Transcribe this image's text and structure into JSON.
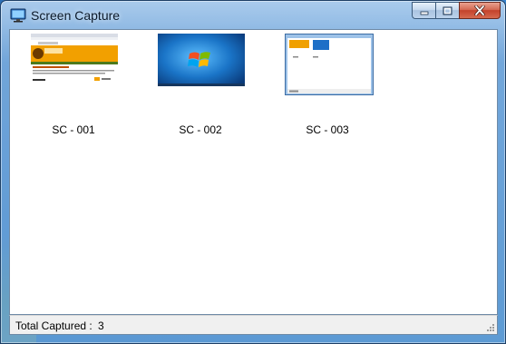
{
  "window": {
    "title": "Screen Capture",
    "icon": "monitor-icon"
  },
  "controls": {
    "minimize_icon": "minimize-icon",
    "maximize_icon": "maximize-icon",
    "close_icon": "close-icon"
  },
  "captures": [
    {
      "label": "SC - 001",
      "preview": "webpage-screenshot"
    },
    {
      "label": "SC - 002",
      "preview": "windows7-desktop-screenshot"
    },
    {
      "label": "SC - 003",
      "preview": "window-screenshot"
    }
  ],
  "status": {
    "label": "Total Captured :",
    "count": "3"
  },
  "colors": {
    "titlebar": "#6fa3d6",
    "close_button": "#c3412a",
    "client_bg": "#ffffff"
  }
}
